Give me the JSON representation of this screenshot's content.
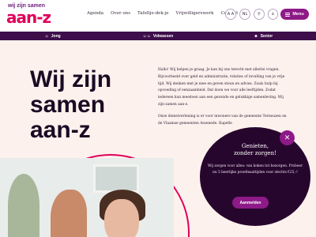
{
  "logo": {
    "top": "wij zijn samen",
    "main": "aan-z"
  },
  "nav": [
    "Agenda",
    "Over ons",
    "Tafeltje-dek-je",
    "Vrijwilligerswerk",
    "Contact"
  ],
  "header_buttons": {
    "font_size": "A A",
    "language": "NL",
    "menu": "Menu"
  },
  "audience": [
    {
      "label": "Jong",
      "icon": "child-icon"
    },
    {
      "label": "Volwassen",
      "icon": "adults-icon"
    },
    {
      "label": "Senior",
      "icon": "senior-icon"
    }
  ],
  "hero": {
    "title": "Wij zijn\nsamen\naan-z",
    "p1": "Hallo! Wij helpen je graag. Je kan bij ons terecht met allerlei vragen. Bijvoorbeeld over geld en administratie, relaties of invulling van je vrije tijd. Wij denken met je mee en geven steun en advies. Zoals hulp bij opvoeding of eenzaamheid. Dat doen we voor alle leeftijden. Zodat iedereen kan meedoen aan een gezonde en gelukkige samenleving. Wij zijn samen aan-z.",
    "p2": "Onze dienstverlening is er voor inwoners van de gemeente Terneuzen en de Vlaamse gemeenten Assenede. Kapelle"
  },
  "popup": {
    "title": "Genieten,\nzonder zorgen!",
    "text": "Wij zorgen voor alles: van koken tot bezorgen. Probeer nu 5 heerlijke proefmaaltijden voor slechts €25,-!",
    "button": "Aanmelden"
  },
  "colors": {
    "brand_magenta": "#e0005a",
    "brand_purple": "#8e1a88",
    "dark_purple": "#3d0e4a"
  }
}
